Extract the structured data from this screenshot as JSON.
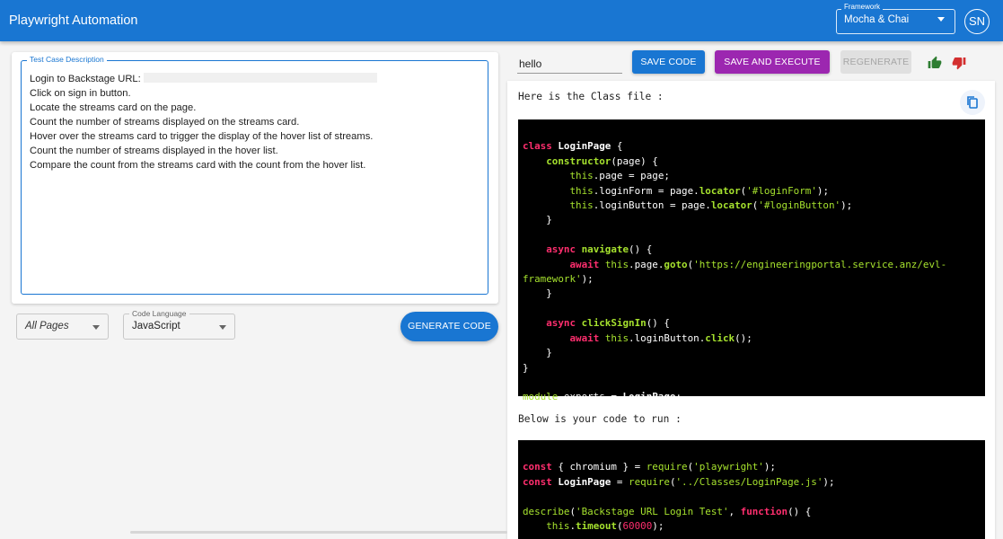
{
  "appbar": {
    "title": "Playwright Automation",
    "framework_label": "Framework",
    "framework_value": "Mocha & Chai",
    "avatar_initials": "SN"
  },
  "test_case": {
    "label": "Test Case Description",
    "lines": [
      "Login to Backstage URL:",
      "Click on sign in button.",
      "Locate the streams card on the page.",
      "Count the number of streams displayed on the streams card.",
      "Hover over the streams card to trigger the display of the hover list of streams.",
      "Count the number of streams displayed in the hover list.",
      "Compare the count from the streams card with the count from the hover list."
    ]
  },
  "controls": {
    "pages_value": "All Pages",
    "language_label": "Code Language",
    "language_value": "JavaScript",
    "generate_label": "GENERATE CODE"
  },
  "toolbar": {
    "input_value": "hello",
    "save_label": "SAVE CODE",
    "save_execute_label": "SAVE AND EXECUTE",
    "regenerate_label": "REGENERATE",
    "thumbs_up_color": "#2e7d32",
    "thumbs_down_color": "#d32f2f"
  },
  "output": {
    "class_heading": "Here is the Class file :",
    "run_heading": "Below is your code to run  :",
    "class_code": [
      [
        "class ",
        "LoginPage",
        " {"
      ],
      [
        "    ",
        "constructor",
        "(page) {"
      ],
      [
        "        ",
        "this",
        ".page = page;"
      ],
      [
        "        ",
        "this",
        ".loginForm = page.",
        "locator",
        "(",
        "'#loginForm'",
        ");"
      ],
      [
        "        ",
        "this",
        ".loginButton = page.",
        "locator",
        "(",
        "'#loginButton'",
        ");"
      ],
      [
        "    }"
      ],
      [
        ""
      ],
      [
        "    ",
        "async ",
        "navigate",
        "() {"
      ],
      [
        "        ",
        "await ",
        "this",
        ".page.",
        "goto",
        "(",
        "'https://engineeringportal.service.anz/evl-",
        ""
      ],
      [
        "framework'",
        ");"
      ],
      [
        "    }"
      ],
      [
        ""
      ],
      [
        "    ",
        "async ",
        "clickSignIn",
        "() {"
      ],
      [
        "        ",
        "await ",
        "this",
        ".loginButton.",
        "click",
        "();"
      ],
      [
        "    }"
      ],
      [
        "}"
      ],
      [
        ""
      ],
      [
        "module",
        ".exports = ",
        "LoginPage",
        ";"
      ]
    ],
    "run_code": [
      [
        "const ",
        "{ chromium } = ",
        "require",
        "(",
        "'playwright'",
        ");"
      ],
      [
        "const ",
        "LoginPage",
        " = ",
        "require",
        "(",
        "'../Classes/LoginPage.js'",
        ");"
      ],
      [
        ""
      ],
      [
        "describe",
        "(",
        "'Backstage URL Login Test'",
        ", ",
        "function",
        "() {"
      ],
      [
        "    ",
        "this",
        ".",
        "timeout",
        "(",
        "60000",
        ");"
      ]
    ]
  }
}
